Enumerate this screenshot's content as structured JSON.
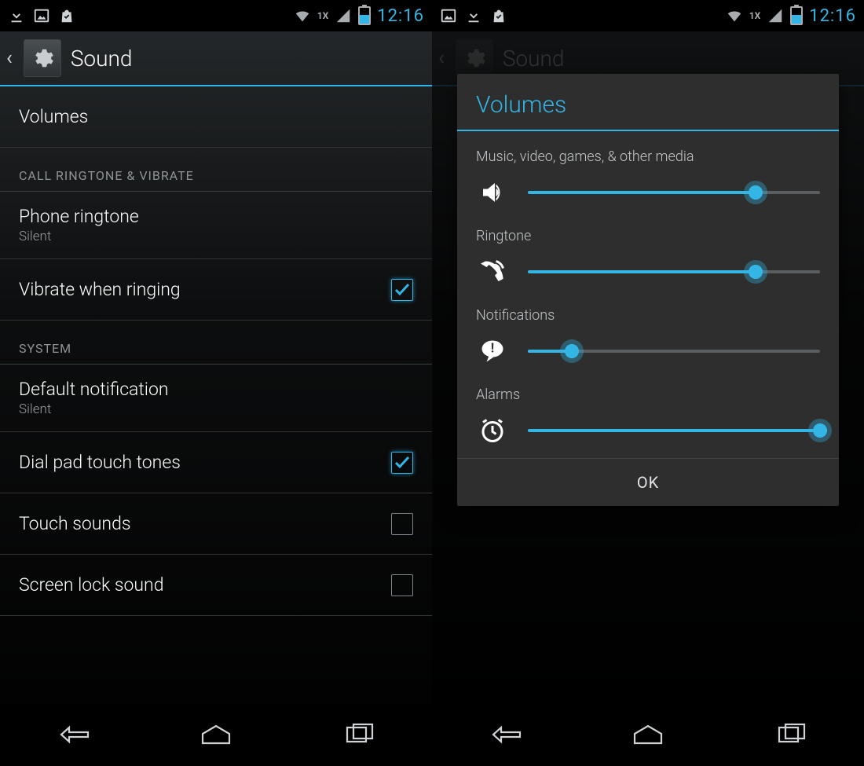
{
  "status": {
    "clock": "12:16",
    "network_badge": "1X"
  },
  "actionbar": {
    "title": "Sound"
  },
  "list": {
    "volumes_label": "Volumes",
    "section_ringtone": "CALL RINGTONE & VIBRATE",
    "phone_ringtone": {
      "label": "Phone ringtone",
      "value": "Silent"
    },
    "vibrate_when_ringing": {
      "label": "Vibrate when ringing",
      "checked": true
    },
    "section_system": "SYSTEM",
    "default_notification": {
      "label": "Default notification",
      "value": "Silent"
    },
    "dial_pad": {
      "label": "Dial pad touch tones",
      "checked": true
    },
    "touch_sounds": {
      "label": "Touch sounds",
      "checked": false
    },
    "screen_lock": {
      "label": "Screen lock sound",
      "checked": false
    }
  },
  "dialog": {
    "title": "Volumes",
    "ok": "OK",
    "sliders": {
      "media": {
        "label": "Music, video, games, & other media",
        "value": 78
      },
      "ringtone": {
        "label": "Ringtone",
        "value": 78
      },
      "notifications": {
        "label": "Notifications",
        "value": 15
      },
      "alarms": {
        "label": "Alarms",
        "value": 100
      }
    }
  }
}
